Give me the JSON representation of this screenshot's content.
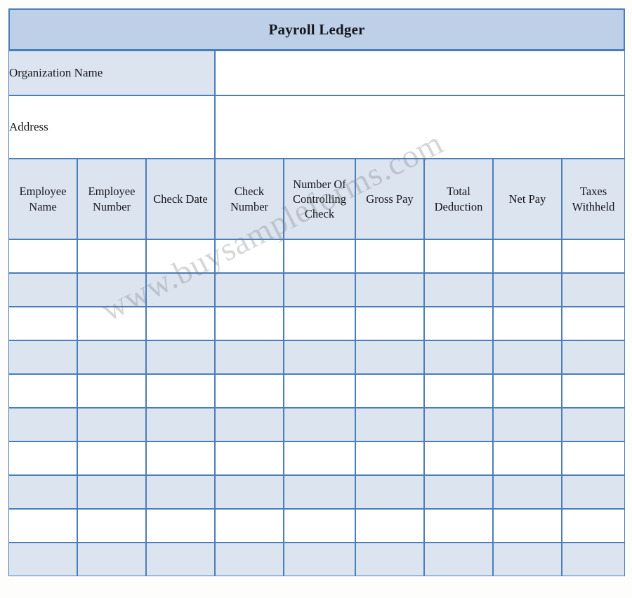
{
  "document": {
    "title": "Payroll Ledger"
  },
  "meta_fields": [
    {
      "label": "Organization Name",
      "value": ""
    },
    {
      "label": "Address",
      "value": ""
    }
  ],
  "table": {
    "columns": [
      "Employee Name",
      "Employee Number",
      "Check Date",
      "Check Number",
      "Number Of Controlling Check",
      "Gross Pay",
      "Total Deduction",
      "Net Pay",
      "Taxes Withheld"
    ],
    "row_count": 10,
    "rows": [
      [
        "",
        "",
        "",
        "",
        "",
        "",
        "",
        "",
        ""
      ],
      [
        "",
        "",
        "",
        "",
        "",
        "",
        "",
        "",
        ""
      ],
      [
        "",
        "",
        "",
        "",
        "",
        "",
        "",
        "",
        ""
      ],
      [
        "",
        "",
        "",
        "",
        "",
        "",
        "",
        "",
        ""
      ],
      [
        "",
        "",
        "",
        "",
        "",
        "",
        "",
        "",
        ""
      ],
      [
        "",
        "",
        "",
        "",
        "",
        "",
        "",
        "",
        ""
      ],
      [
        "",
        "",
        "",
        "",
        "",
        "",
        "",
        "",
        ""
      ],
      [
        "",
        "",
        "",
        "",
        "",
        "",
        "",
        "",
        ""
      ],
      [
        "",
        "",
        "",
        "",
        "",
        "",
        "",
        "",
        ""
      ],
      [
        "",
        "",
        "",
        "",
        "",
        "",
        "",
        "",
        ""
      ]
    ]
  },
  "watermark": {
    "text": "www.buysampleforms.com"
  },
  "colors": {
    "title_fill": "#bdd0e8",
    "header_fill": "#dce4f0",
    "row_alt_fill": "#dce4f0",
    "row_fill": "#ffffff",
    "border": "#4a7ebb",
    "text": "#16171c",
    "watermark": "#787676"
  }
}
